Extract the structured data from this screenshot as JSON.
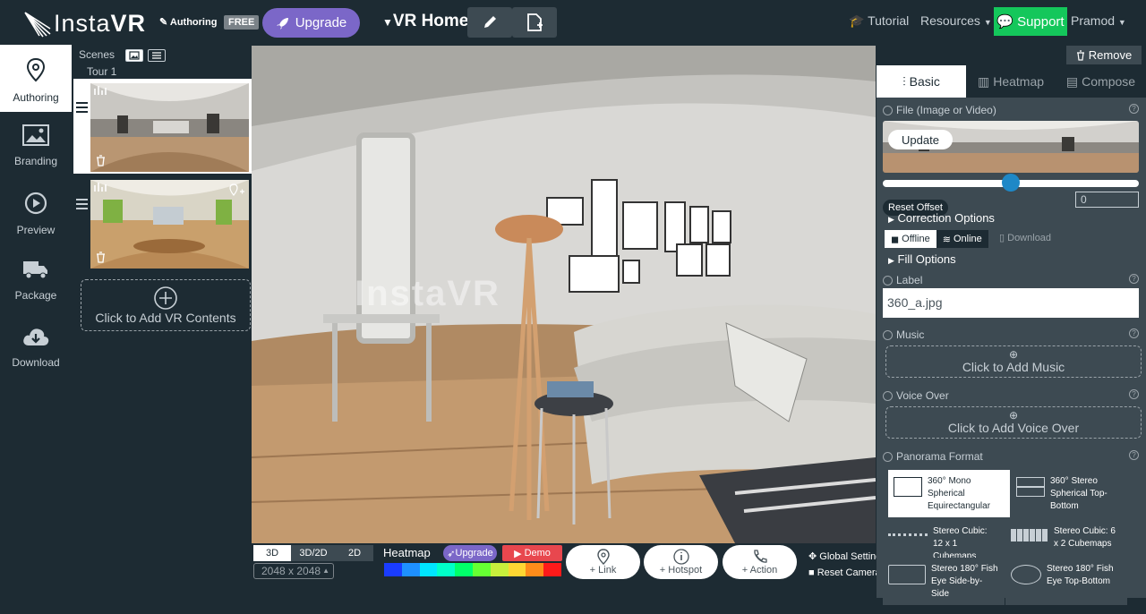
{
  "header": {
    "logo_text": "Insta",
    "logo_text_bold": "VR",
    "authoring_label": "Authoring",
    "plan_badge": "FREE",
    "upgrade_label": "Upgrade",
    "project_title": "VR Home",
    "tutorial_label": "Tutorial",
    "resources_label": "Resources",
    "support_label": "Support",
    "user_label": "Pramod"
  },
  "leftnav": {
    "items": [
      {
        "label": "Authoring",
        "icon": "map-pin-icon"
      },
      {
        "label": "Branding",
        "icon": "image-icon"
      },
      {
        "label": "Preview",
        "icon": "play-icon"
      },
      {
        "label": "Package",
        "icon": "truck-icon"
      },
      {
        "label": "Download",
        "icon": "cloud-download-icon"
      }
    ]
  },
  "scenes": {
    "title": "Scenes",
    "tour_label": "Tour 1",
    "add_label": "Click to Add VR Contents"
  },
  "viewer": {
    "watermark": "InstaVR"
  },
  "bottombar": {
    "modes": [
      "3D",
      "3D/2D",
      "2D"
    ],
    "resolution": "2048 x 2048",
    "heatmap_label": "Heatmap",
    "upgrade_label": "Upgrade",
    "demo_label": "Demo",
    "heat_colors": [
      "#1a3cff",
      "#1e90ff",
      "#00e5ff",
      "#00ffc8",
      "#00ff6a",
      "#66ff33",
      "#c8f03c",
      "#ffd733",
      "#ff8c1a",
      "#ff1a1a"
    ],
    "link_label": "+ Link",
    "hotspot_label": "+ Hotspot",
    "action_label": "+ Action",
    "global_settings": "Global Settings",
    "reset_camera": "Reset Camera"
  },
  "rightpanel": {
    "remove_label": "Remove",
    "tabs": [
      "Basic",
      "Heatmap",
      "Compose"
    ],
    "file_title": "File (Image or Video)",
    "update_label": "Update",
    "reset_offset": "Reset Offset",
    "offset_value": "0",
    "correction_options": "Correction Options",
    "offline_label": "Offline",
    "online_label": "Online",
    "download_label": "Download",
    "fill_options": "Fill Options",
    "label_title": "Label",
    "label_value": "360_a.jpg",
    "music_title": "Music",
    "music_add": "Click to Add Music",
    "voice_title": "Voice Over",
    "voice_add": "Click to Add Voice Over",
    "pano_title": "Panorama Format",
    "pano_options": [
      "360° Mono Spherical Equirectangular",
      "360° Stereo Spherical Top-Bottom",
      "Stereo Cubic: 12 x 1 Cubemaps",
      "Stereo Cubic: 6 x 2 Cubemaps",
      "Stereo 180° Fish Eye Side-by-Side",
      "Stereo 180° Fish Eye Top-Bottom"
    ]
  }
}
